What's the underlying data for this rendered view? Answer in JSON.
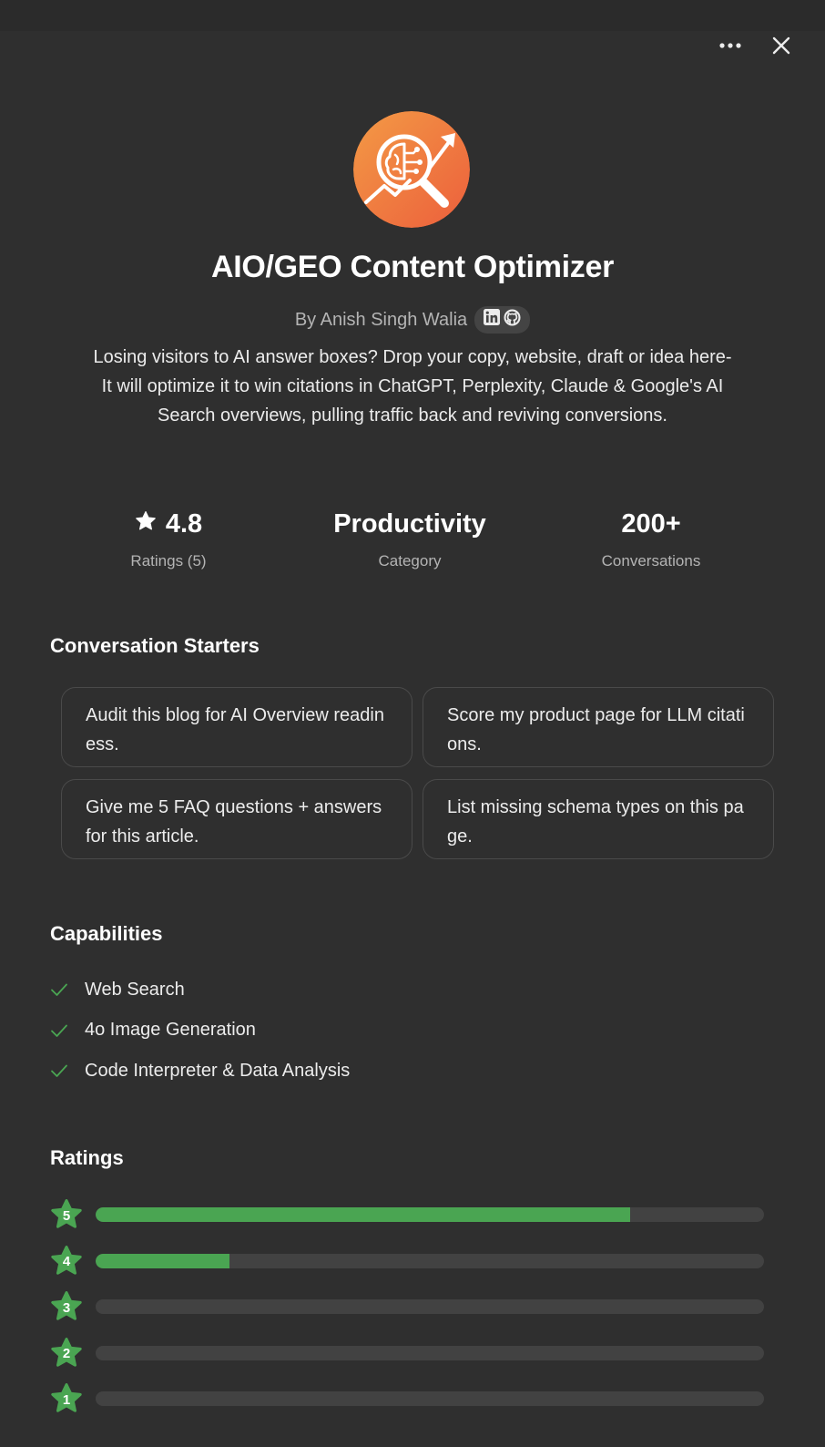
{
  "header": {
    "more_icon": "more-horizontal-icon",
    "close_icon": "close-icon"
  },
  "gpt": {
    "title": "AIO/GEO Content Optimizer",
    "author": "By Anish Singh Walia",
    "social_icons": [
      "linkedin-icon",
      "github-icon"
    ],
    "description": "Losing visitors to AI answer boxes? Drop your copy, website, draft or idea here-It will optimize it to win citations in ChatGPT, Perplexity, Claude & Google's AI Search overviews, pulling traffic back and reviving conversions.",
    "accent_color": "#f07a3c"
  },
  "stats": [
    {
      "value": "4.8",
      "label": "Ratings (5)",
      "icon": "star-icon"
    },
    {
      "value": "Productivity",
      "label": "Category"
    },
    {
      "value": "200+",
      "label": "Conversations"
    }
  ],
  "starters": {
    "title": "Conversation Starters",
    "items": [
      "Audit this blog for AI Overview readiness.",
      "Score my product page for LLM citations.",
      "Give me 5 FAQ questions + answers for this article.",
      "List missing schema types on this page."
    ]
  },
  "capabilities": {
    "title": "Capabilities",
    "items": [
      "Web Search",
      "4o Image Generation",
      "Code Interpreter & Data Analysis"
    ],
    "check_color": "#4aa552"
  },
  "ratings": {
    "title": "Ratings",
    "bar_color": "#4aa552",
    "rows": [
      {
        "stars": "5",
        "fraction": 0.8
      },
      {
        "stars": "4",
        "fraction": 0.2
      },
      {
        "stars": "3",
        "fraction": 0
      },
      {
        "stars": "2",
        "fraction": 0
      },
      {
        "stars": "1",
        "fraction": 0
      }
    ]
  }
}
